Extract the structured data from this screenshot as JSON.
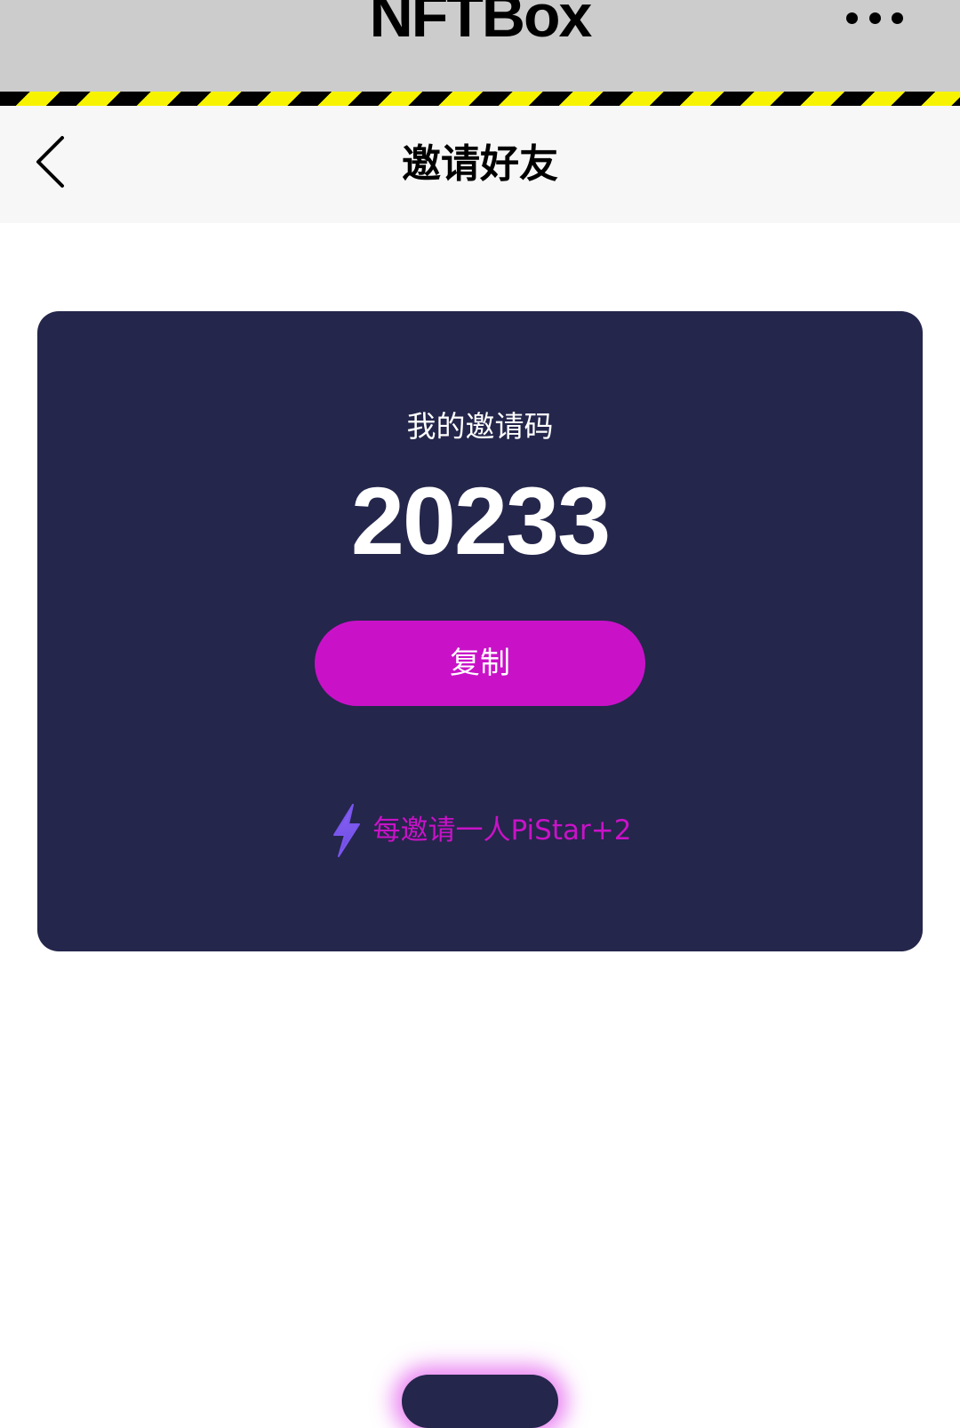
{
  "app_bar": {
    "title": "NFTBox",
    "more_icon": "more-dots-icon",
    "background": "#cccccc",
    "stripe_colors": [
      "#000000",
      "#f7f300"
    ]
  },
  "nav": {
    "back_icon": "chevron-left-icon",
    "title": "邀请好友",
    "background": "#f7f7f7"
  },
  "invite_card": {
    "background": "#24264b",
    "label": "我的邀请码",
    "code": "20233",
    "copy_button_label": "复制",
    "copy_button_color": "#c912c8",
    "reward_icon": "lightning-bolt-icon",
    "reward_text": "每邀请一人PiStar+2",
    "reward_color": "#c912c8"
  },
  "floating_action": {
    "glow_color": "#e66ef0"
  }
}
